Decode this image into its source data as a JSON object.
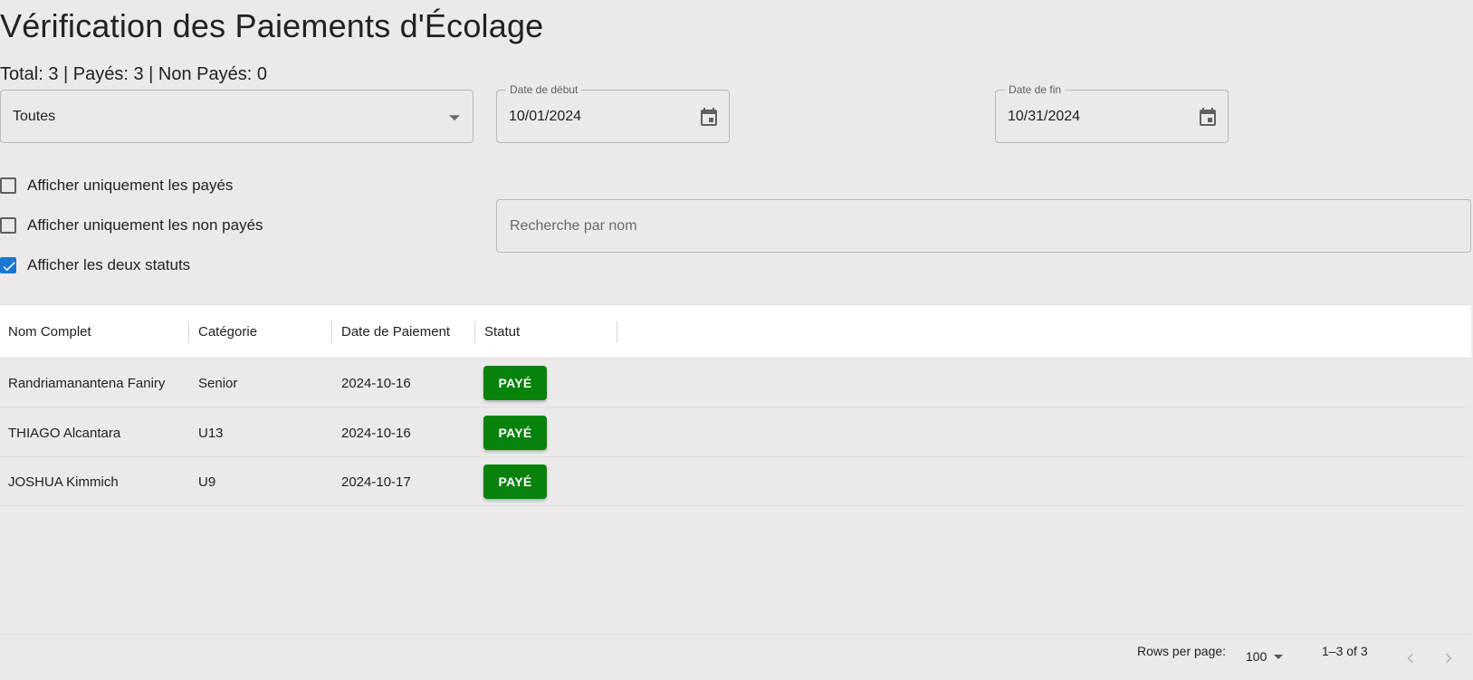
{
  "header": {
    "title": "Vérification des Paiements d'Écolage",
    "summary": "Total: 3 | Payés: 3 | Non Payés: 0"
  },
  "filters": {
    "category_select": {
      "value": "Toutes"
    },
    "date_start": {
      "label": "Date de début",
      "value": "10/01/2024"
    },
    "date_end": {
      "label": "Date de fin",
      "value": "10/31/2024"
    },
    "search": {
      "placeholder": "Recherche par nom"
    },
    "checkboxes": [
      {
        "label": "Afficher uniquement les payés",
        "checked": false
      },
      {
        "label": "Afficher uniquement les non payés",
        "checked": false
      },
      {
        "label": "Afficher les deux statuts",
        "checked": true
      }
    ]
  },
  "table": {
    "columns": [
      "Nom Complet",
      "Catégorie",
      "Date de Paiement",
      "Statut"
    ],
    "rows": [
      {
        "name": "Randriamanantena Faniry",
        "category": "Senior",
        "date": "2024-10-16",
        "status": "PAYÉ"
      },
      {
        "name": "THIAGO Alcantara",
        "category": "U13",
        "date": "2024-10-16",
        "status": "PAYÉ"
      },
      {
        "name": "JOSHUA Kimmich",
        "category": "U9",
        "date": "2024-10-17",
        "status": "PAYÉ"
      }
    ]
  },
  "pagination": {
    "rows_per_page_label": "Rows per page:",
    "rows_per_page_value": "100",
    "range": "1–3 of 3"
  },
  "colors": {
    "background": "#ebe9ea",
    "status_paid": "#07820a",
    "checkbox_accent": "#1976d2"
  },
  "icons": [
    "calendar-icon",
    "chevron-down-icon",
    "check-icon",
    "chevron-left-icon",
    "chevron-right-icon"
  ]
}
